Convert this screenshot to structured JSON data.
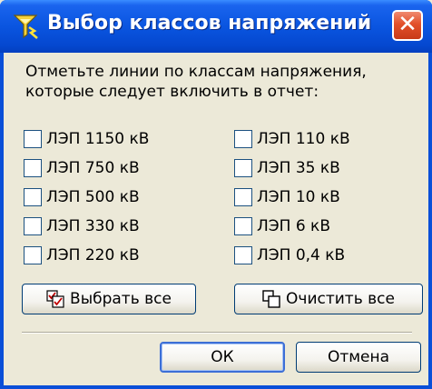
{
  "window": {
    "title": "Выбор классов напряжений",
    "close_glyph": "✕"
  },
  "instruction": {
    "line1": "Отметьте линии по классам напряжения,",
    "line2": "которые следует включить в отчет:"
  },
  "left_column": [
    {
      "label": "ЛЭП 1150 кВ",
      "checked": false
    },
    {
      "label": "ЛЭП 750 кВ",
      "checked": false
    },
    {
      "label": "ЛЭП 500 кВ",
      "checked": false
    },
    {
      "label": "ЛЭП 330 кВ",
      "checked": false
    },
    {
      "label": "ЛЭП 220 кВ",
      "checked": false
    }
  ],
  "right_column": [
    {
      "label": "ЛЭП 110 кВ",
      "checked": false
    },
    {
      "label": "ЛЭП 35 кВ",
      "checked": false
    },
    {
      "label": "ЛЭП 10 кВ",
      "checked": false
    },
    {
      "label": "ЛЭП 6 кВ",
      "checked": false
    },
    {
      "label": "ЛЭП 0,4 кВ",
      "checked": false
    }
  ],
  "buttons": {
    "select_all": "Выбрать все",
    "clear_all": "Очистить все",
    "ok": "ОК",
    "cancel": "Отмена"
  },
  "icons": {
    "title": "lightning-filter-icon",
    "select_all": "select-all-icon",
    "clear_all": "clear-all-icon"
  },
  "colors": {
    "titlebar": "#0a55e0",
    "client": "#ece9d8",
    "close": "#e2502a",
    "button_border": "#003c74"
  }
}
